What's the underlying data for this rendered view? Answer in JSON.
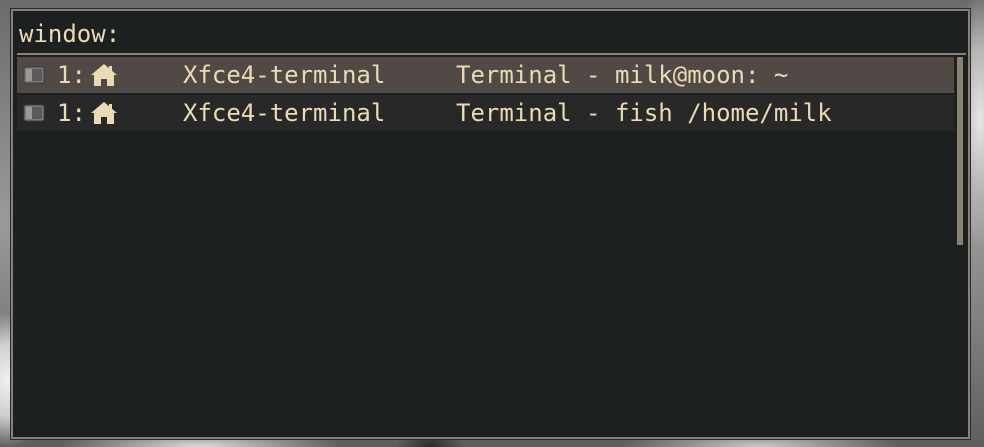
{
  "prompt": {
    "label": "window:",
    "value": ""
  },
  "entries": [
    {
      "workspace": "1:",
      "workspace_icon": "home-icon",
      "app_icon": "terminal-icon",
      "window_class": "Xfce4-terminal",
      "window_title": "Terminal - milk@moon: ~",
      "selected": true
    },
    {
      "workspace": "1:",
      "workspace_icon": "home-icon",
      "app_icon": "terminal-icon",
      "window_class": "Xfce4-terminal",
      "window_title": "Terminal - fish /home/milk",
      "selected": false
    }
  ],
  "colors": {
    "background": "#1d2021",
    "foreground": "#ebdbb2",
    "border": "#8a8170",
    "selected_row": "#504945",
    "alternate_row": "#282828"
  }
}
